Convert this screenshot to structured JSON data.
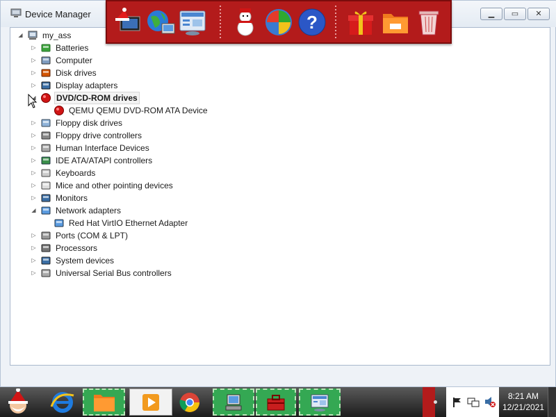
{
  "window": {
    "title": "Device Manager"
  },
  "tree": {
    "root": "my_ass",
    "items": [
      {
        "label": "Batteries",
        "icon": "battery-icon",
        "expander": "collapsed"
      },
      {
        "label": "Computer",
        "icon": "computer-icon",
        "expander": "collapsed"
      },
      {
        "label": "Disk drives",
        "icon": "disk-drive-icon",
        "expander": "collapsed"
      },
      {
        "label": "Display adapters",
        "icon": "display-adapter-icon",
        "expander": "collapsed"
      },
      {
        "label": "DVD/CD-ROM drives",
        "icon": "dvd-drive-icon",
        "expander": "expanded",
        "selected": true
      },
      {
        "label": "QEMU QEMU DVD-ROM ATA Device",
        "icon": "dvd-device-icon",
        "child": true
      },
      {
        "label": "Floppy disk drives",
        "icon": "floppy-disk-icon",
        "expander": "collapsed"
      },
      {
        "label": "Floppy drive controllers",
        "icon": "floppy-controller-icon",
        "expander": "collapsed"
      },
      {
        "label": "Human Interface Devices",
        "icon": "hid-icon",
        "expander": "collapsed"
      },
      {
        "label": "IDE ATA/ATAPI controllers",
        "icon": "ide-controller-icon",
        "expander": "collapsed"
      },
      {
        "label": "Keyboards",
        "icon": "keyboard-icon",
        "expander": "collapsed"
      },
      {
        "label": "Mice and other pointing devices",
        "icon": "mouse-icon",
        "expander": "collapsed"
      },
      {
        "label": "Monitors",
        "icon": "monitor-icon",
        "expander": "collapsed"
      },
      {
        "label": "Network adapters",
        "icon": "network-adapter-icon",
        "expander": "expanded"
      },
      {
        "label": "Red Hat VirtIO Ethernet Adapter",
        "icon": "ethernet-adapter-icon",
        "child": true
      },
      {
        "label": "Ports (COM & LPT)",
        "icon": "port-icon",
        "expander": "collapsed"
      },
      {
        "label": "Processors",
        "icon": "processor-icon",
        "expander": "collapsed"
      },
      {
        "label": "System devices",
        "icon": "system-device-icon",
        "expander": "collapsed"
      },
      {
        "label": "Universal Serial Bus controllers",
        "icon": "usb-icon",
        "expander": "collapsed"
      }
    ]
  },
  "dock": {
    "icons": [
      "santa-computer-icon",
      "globe-icon",
      "control-panel-icon",
      "snowman-icon",
      "windows-flag-icon",
      "help-icon",
      "gift-icon",
      "folder-icon",
      "recycle-bin-icon"
    ]
  },
  "taskbar": {
    "clock_time": "8:21 AM",
    "clock_date": "12/21/2021"
  },
  "colors": {
    "dock": "#b31b1b",
    "taskbar_green": "#34a853",
    "dvd_red": "#d01515"
  }
}
